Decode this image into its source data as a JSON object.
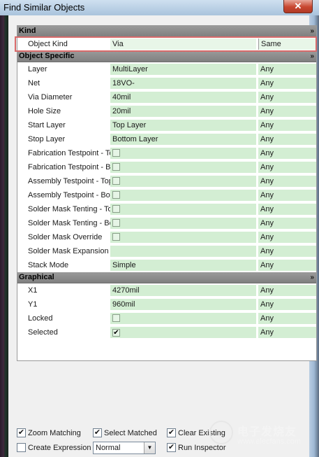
{
  "window": {
    "title": "Find Similar Objects",
    "close_label": "✕"
  },
  "sections": {
    "kind": {
      "label": "Kind",
      "chevron": "»"
    },
    "object_specific": {
      "label": "Object Specific",
      "chevron": "»"
    },
    "graphical": {
      "label": "Graphical",
      "chevron": "»"
    }
  },
  "kind_rows": [
    {
      "name": "Object Kind",
      "value": "Via",
      "compare": "Same"
    }
  ],
  "object_rows": [
    {
      "name": "Layer",
      "value": "MultiLayer",
      "compare": "Any"
    },
    {
      "name": "Net",
      "value": "18VO-",
      "compare": "Any"
    },
    {
      "name": "Via Diameter",
      "value": "40mil",
      "compare": "Any"
    },
    {
      "name": "Hole Size",
      "value": "20mil",
      "compare": "Any"
    },
    {
      "name": "Start Layer",
      "value": "Top Layer",
      "compare": "Any"
    },
    {
      "name": "Stop Layer",
      "value": "Bottom Layer",
      "compare": "Any"
    },
    {
      "name": "Fabrication Testpoint - Top",
      "value": "",
      "compare": "Any"
    },
    {
      "name": "Fabrication Testpoint - Bottom",
      "value": "",
      "compare": "Any"
    },
    {
      "name": "Assembly Testpoint - Top",
      "value": "",
      "compare": "Any"
    },
    {
      "name": "Assembly Testpoint - Bottom",
      "value": "",
      "compare": "Any"
    },
    {
      "name": "Solder Mask Tenting - Top",
      "value": "",
      "compare": "Any"
    },
    {
      "name": "Solder Mask Tenting - Bottom",
      "value": "",
      "compare": "Any"
    },
    {
      "name": "Solder Mask Override",
      "value": "",
      "compare": "Any"
    },
    {
      "name": "Solder Mask Expansion",
      "value": "",
      "compare": "Any"
    },
    {
      "name": "Stack Mode",
      "value": "Simple",
      "compare": "Any"
    }
  ],
  "graphical_rows": [
    {
      "name": "X1",
      "value": "4270mil",
      "compare": "Any"
    },
    {
      "name": "Y1",
      "value": "960mil",
      "compare": "Any"
    },
    {
      "name": "Locked",
      "value": "",
      "compare": "Any"
    },
    {
      "name": "Selected",
      "value": "✔",
      "compare": "Any"
    }
  ],
  "bottom": {
    "zoom_matching": {
      "label": "Zoom Matching",
      "checked": "✔"
    },
    "select_matched": {
      "label": "Select Matched",
      "checked": "✔"
    },
    "clear_existing": {
      "label": "Clear Existing",
      "checked": "✔"
    },
    "create_expression": {
      "label": "Create Expression",
      "checked": ""
    },
    "mode_select": {
      "value": "Normal",
      "arrow": "▼"
    },
    "run_inspector": {
      "label": "Run Inspector",
      "checked": "✔"
    }
  },
  "watermark": {
    "line1": "电子发烧友",
    "line2": "www.elecfans.com"
  },
  "colors": {
    "value_cell": "#d3eed3",
    "section_header": "#8f8f8f",
    "highlight_border": "#d86a6a"
  }
}
